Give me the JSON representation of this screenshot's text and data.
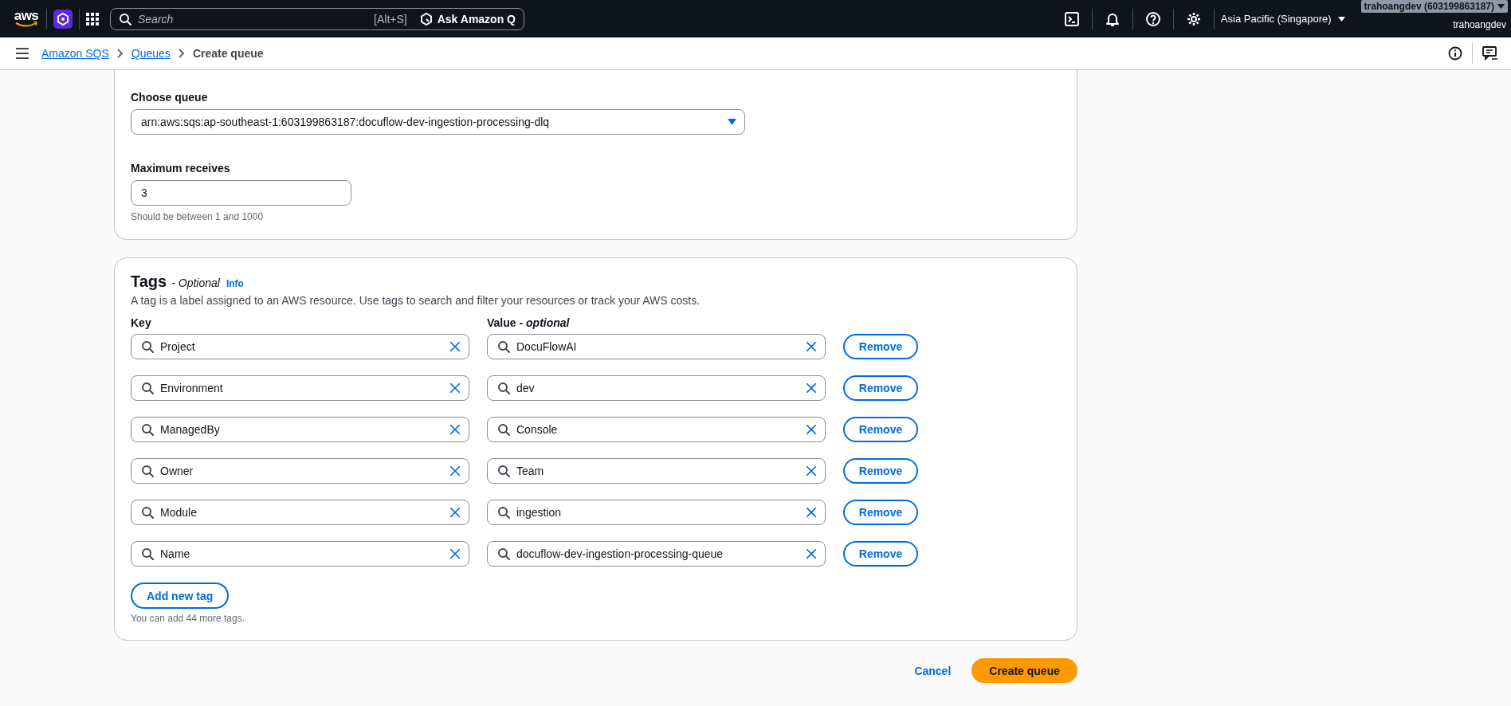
{
  "top_nav": {
    "logo": "aws",
    "search": {
      "placeholder": "Search",
      "shortcut": "[Alt+S]"
    },
    "ask_q": "Ask Amazon Q",
    "region": "Asia Pacific (Singapore)",
    "account": "trahoangdev (603199863187)",
    "username": "trahoangdev"
  },
  "breadcrumbs": [
    {
      "label": "Amazon SQS",
      "kind": "link"
    },
    {
      "label": "Queues",
      "kind": "link"
    },
    {
      "label": "Create queue",
      "kind": "current"
    }
  ],
  "dead_letter": {
    "choose_queue": {
      "label": "Choose queue",
      "value": "arn:aws:sqs:ap-southeast-1:603199863187:docuflow-dev-ingestion-processing-dlq"
    },
    "max_receives": {
      "label": "Maximum receives",
      "value": "3",
      "hint": "Should be between 1 and 1000"
    }
  },
  "tags": {
    "title": "Tags",
    "optional": "- Optional",
    "info": "Info",
    "description": "A tag is a label assigned to an AWS resource. Use tags to search and filter your resources or track your AWS costs.",
    "key_header": "Key",
    "value_header": "Value - *optional*",
    "rows": [
      {
        "key": "Project",
        "value": "DocuFlowAI",
        "remove": "Remove"
      },
      {
        "key": "Environment",
        "value": "dev",
        "remove": "Remove"
      },
      {
        "key": "ManagedBy",
        "value": "Console",
        "remove": "Remove"
      },
      {
        "key": "Owner",
        "value": "Team",
        "remove": "Remove"
      },
      {
        "key": "Module",
        "value": "ingestion",
        "remove": "Remove"
      },
      {
        "key": "Name",
        "value": "docuflow-dev-ingestion-processing-queue",
        "remove": "Remove"
      }
    ],
    "add_button": "Add new tag",
    "hint": "You can add 44 more tags."
  },
  "actions": {
    "cancel": "Cancel",
    "create": "Create queue"
  }
}
